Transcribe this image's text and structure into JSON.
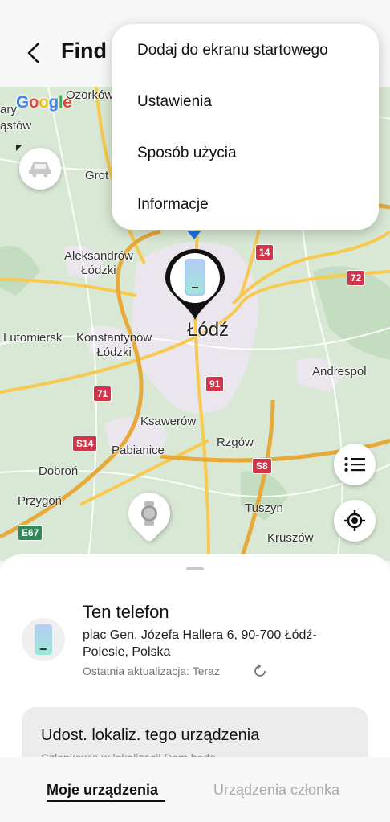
{
  "header": {
    "title": "Find"
  },
  "map": {
    "google_logo": "Google",
    "labels": {
      "ozorkow": "Ozorków",
      "zgierz_fragment": "ary",
      "glowno_fragment": "ąstów",
      "grotniki_fragment": "Grot",
      "aleksandrow": "Aleksandrów\nŁódzki",
      "lutomiersk": "Lutomiersk",
      "konstantynow": "Konstantynów\nŁódzki",
      "lodz": "Łódź",
      "andrespol": "Andrespol",
      "ksawerow": "Ksawerów",
      "pabianice": "Pabianice",
      "rzgow": "Rzgów",
      "dobron": "Dobroń",
      "przygon": "Przygoń",
      "tuszyn": "Tuszyn",
      "kruszow": "Kruszów"
    },
    "roads": {
      "r14": "14",
      "r72": "72",
      "r71": "71",
      "r91": "91",
      "s14": "S14",
      "s8": "S8",
      "e67": "E67"
    },
    "colors": {
      "land": "#d9e8d4",
      "urban": "#ebe6ee",
      "road": "#f7c94f",
      "express": "#e6a93a",
      "badge_red": "#d0354a",
      "badge_green": "#2e8b57"
    }
  },
  "menu": {
    "items": [
      "Dodaj do ekranu startowego",
      "Ustawienia",
      "Sposób użycia",
      "Informacje"
    ]
  },
  "device": {
    "name": "Ten telefon",
    "address": "plac Gen. Józefa Hallera 6, 90-700 Łódź-Polesie, Polska",
    "updated": "Ostatnia aktualizacja: Teraz"
  },
  "share": {
    "title": "Udost. lokaliz. tego urządzenia",
    "subtitle": "Członkowie w lokalizacji Dom będą"
  },
  "tabs": {
    "mine": "Moje urządzenia",
    "members": "Urządzenia członka"
  }
}
